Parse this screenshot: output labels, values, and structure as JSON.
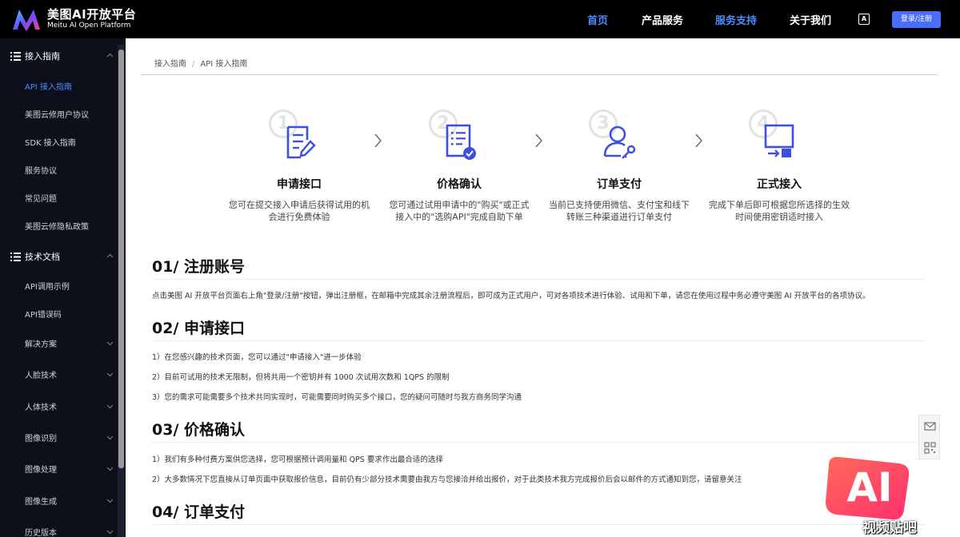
{
  "header": {
    "logo_cn": "美图AI开放平台",
    "logo_en": "Meitu AI Open Platform",
    "nav": [
      {
        "label": "首页",
        "active": true
      },
      {
        "label": "产品服务",
        "active": false
      },
      {
        "label": "服务支持",
        "active": true
      },
      {
        "label": "关于我们",
        "active": false
      }
    ],
    "lang_icon": "A",
    "login_label": "登录/注册"
  },
  "sidebar": {
    "groups": [
      {
        "label": "接入指南",
        "items": [
          "API 接入指南",
          "美图云修用户协议",
          "SDK 接入指南",
          "服务协议",
          "常见问题",
          "美图云修隐私政策"
        ]
      },
      {
        "label": "技术文档",
        "items": [
          "API调用示例",
          "API错误码"
        ]
      }
    ],
    "collapsed": [
      "解决方案",
      "人脸技术",
      "人体技术",
      "图像识别",
      "图像处理",
      "图像生成",
      "历史版本"
    ],
    "active_item": "API 接入指南"
  },
  "breadcrumb": [
    "接入指南",
    "API 接入指南"
  ],
  "steps": [
    {
      "num": "1",
      "title": "申请接口",
      "desc": "您可在提交接入申请后获得试用的机会进行免费体验",
      "icon": "form-edit-icon"
    },
    {
      "num": "2",
      "title": "价格确认",
      "desc": "您可通过试用申请中的\"购买\"或正式接入中的\"选购API\"完成自助下单",
      "icon": "list-check-icon"
    },
    {
      "num": "3",
      "title": "订单支付",
      "desc": "当前已支持使用微信、支付宝和线下转账三种渠道进行订单支付",
      "icon": "user-key-icon"
    },
    {
      "num": "4",
      "title": "正式接入",
      "desc": "完成下单后即可根据您所选择的生效时间使用密钥适时接入",
      "icon": "monitor-access-icon"
    }
  ],
  "sections": [
    {
      "title": "01/ 注册账号",
      "paras": [
        "点击美图 AI 开放平台页面右上角\"登录/注册\"按钮，弹出注册框，在邮箱中完成其余注册流程后，即可成为正式用户，可对各项技术进行体验、试用和下单，请您在使用过程中务必遵守美图 AI 开放平台的各项协议。"
      ]
    },
    {
      "title": "02/ 申请接口",
      "paras": [
        "1）在您感兴趣的技术页面，您可以通过\"申请接入\"进一步体验",
        "2）目前可试用的技术无限制，但将共用一个密钥并有 1000 次试用次数和 1QPS 的限制",
        "3）您的需求可能需要多个技术共同实现时，可能需要同时购买多个接口，您的疑问可随时与我方商务同学沟通"
      ]
    },
    {
      "title": "03/ 价格确认",
      "paras": [
        "1）我们有多种付费方案供您选择，您可根据预计调用量和 QPS 要求作出最合适的选择",
        "2）大多数情况下您直接从订单页面中获取报价信息，目前仍有少部分技术需要由我方与您接洽并给出报价，对于此类技术我方完成报价后会以邮件的方式通知到您，请留意关注"
      ]
    },
    {
      "title": "04/ 订单支付",
      "paras": []
    }
  ],
  "float_tools": [
    "mail-icon",
    "qrcode-icon"
  ],
  "watermark": {
    "big": "AI",
    "small": "视频贴吧"
  },
  "colors": {
    "accent": "#4a8cff",
    "button": "#4a6dfb",
    "icon_primary": "#3d4fe0",
    "sidebar_bg": "#0d0f1a"
  }
}
